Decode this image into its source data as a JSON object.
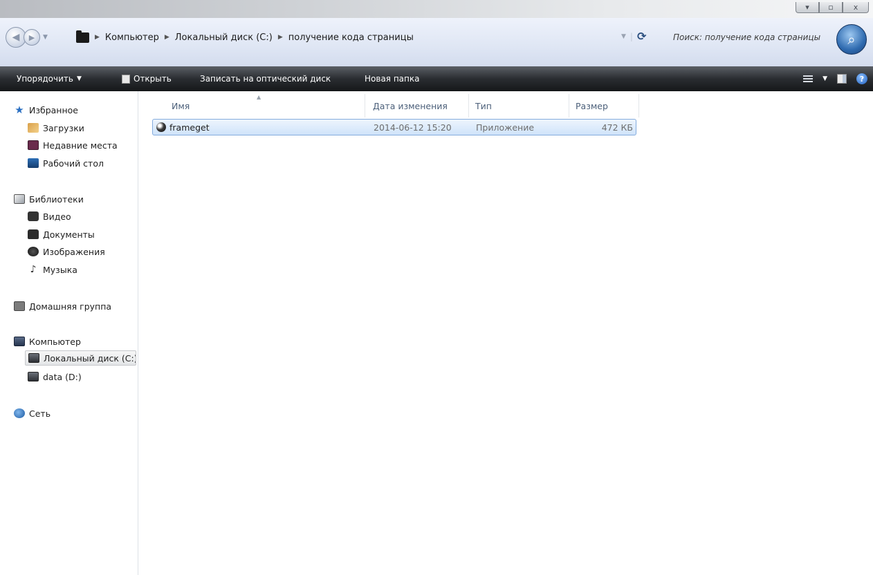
{
  "window": {
    "controls": {
      "minimize": "▾",
      "maximize": "▫",
      "close": "x"
    }
  },
  "address_bar": {
    "back_icon": "back-arrow-icon",
    "forward_icon": "forward-arrow-icon",
    "crumbs": [
      "Компьютер",
      "Локальный диск (C:)",
      "получение кода страницы"
    ],
    "search_placeholder": "Поиск: получение кода страницы"
  },
  "toolbar": {
    "organize": "Упорядочить",
    "open": "Открыть",
    "burn": "Записать на оптический диск",
    "new_folder": "Новая папка"
  },
  "nav": {
    "favorites": "Избранное",
    "downloads": "Загрузки",
    "recent": "Недавние места",
    "desktop": "Рабочий стол",
    "libraries": "Библиотеки",
    "video": "Видео",
    "documents": "Документы",
    "pictures": "Изображения",
    "music": "Музыка",
    "homegroup": "Домашняя группа",
    "computer": "Компьютер",
    "disk_c": "Локальный диск (C:)",
    "disk_d": "data (D:)",
    "network": "Сеть"
  },
  "columns": {
    "name": "Имя",
    "date": "Дата изменения",
    "type": "Тип",
    "size": "Размер"
  },
  "files": [
    {
      "name": "frameget",
      "date": "2014-06-12 15:20",
      "type": "Приложение",
      "size": "472 КБ",
      "selected": true
    }
  ]
}
